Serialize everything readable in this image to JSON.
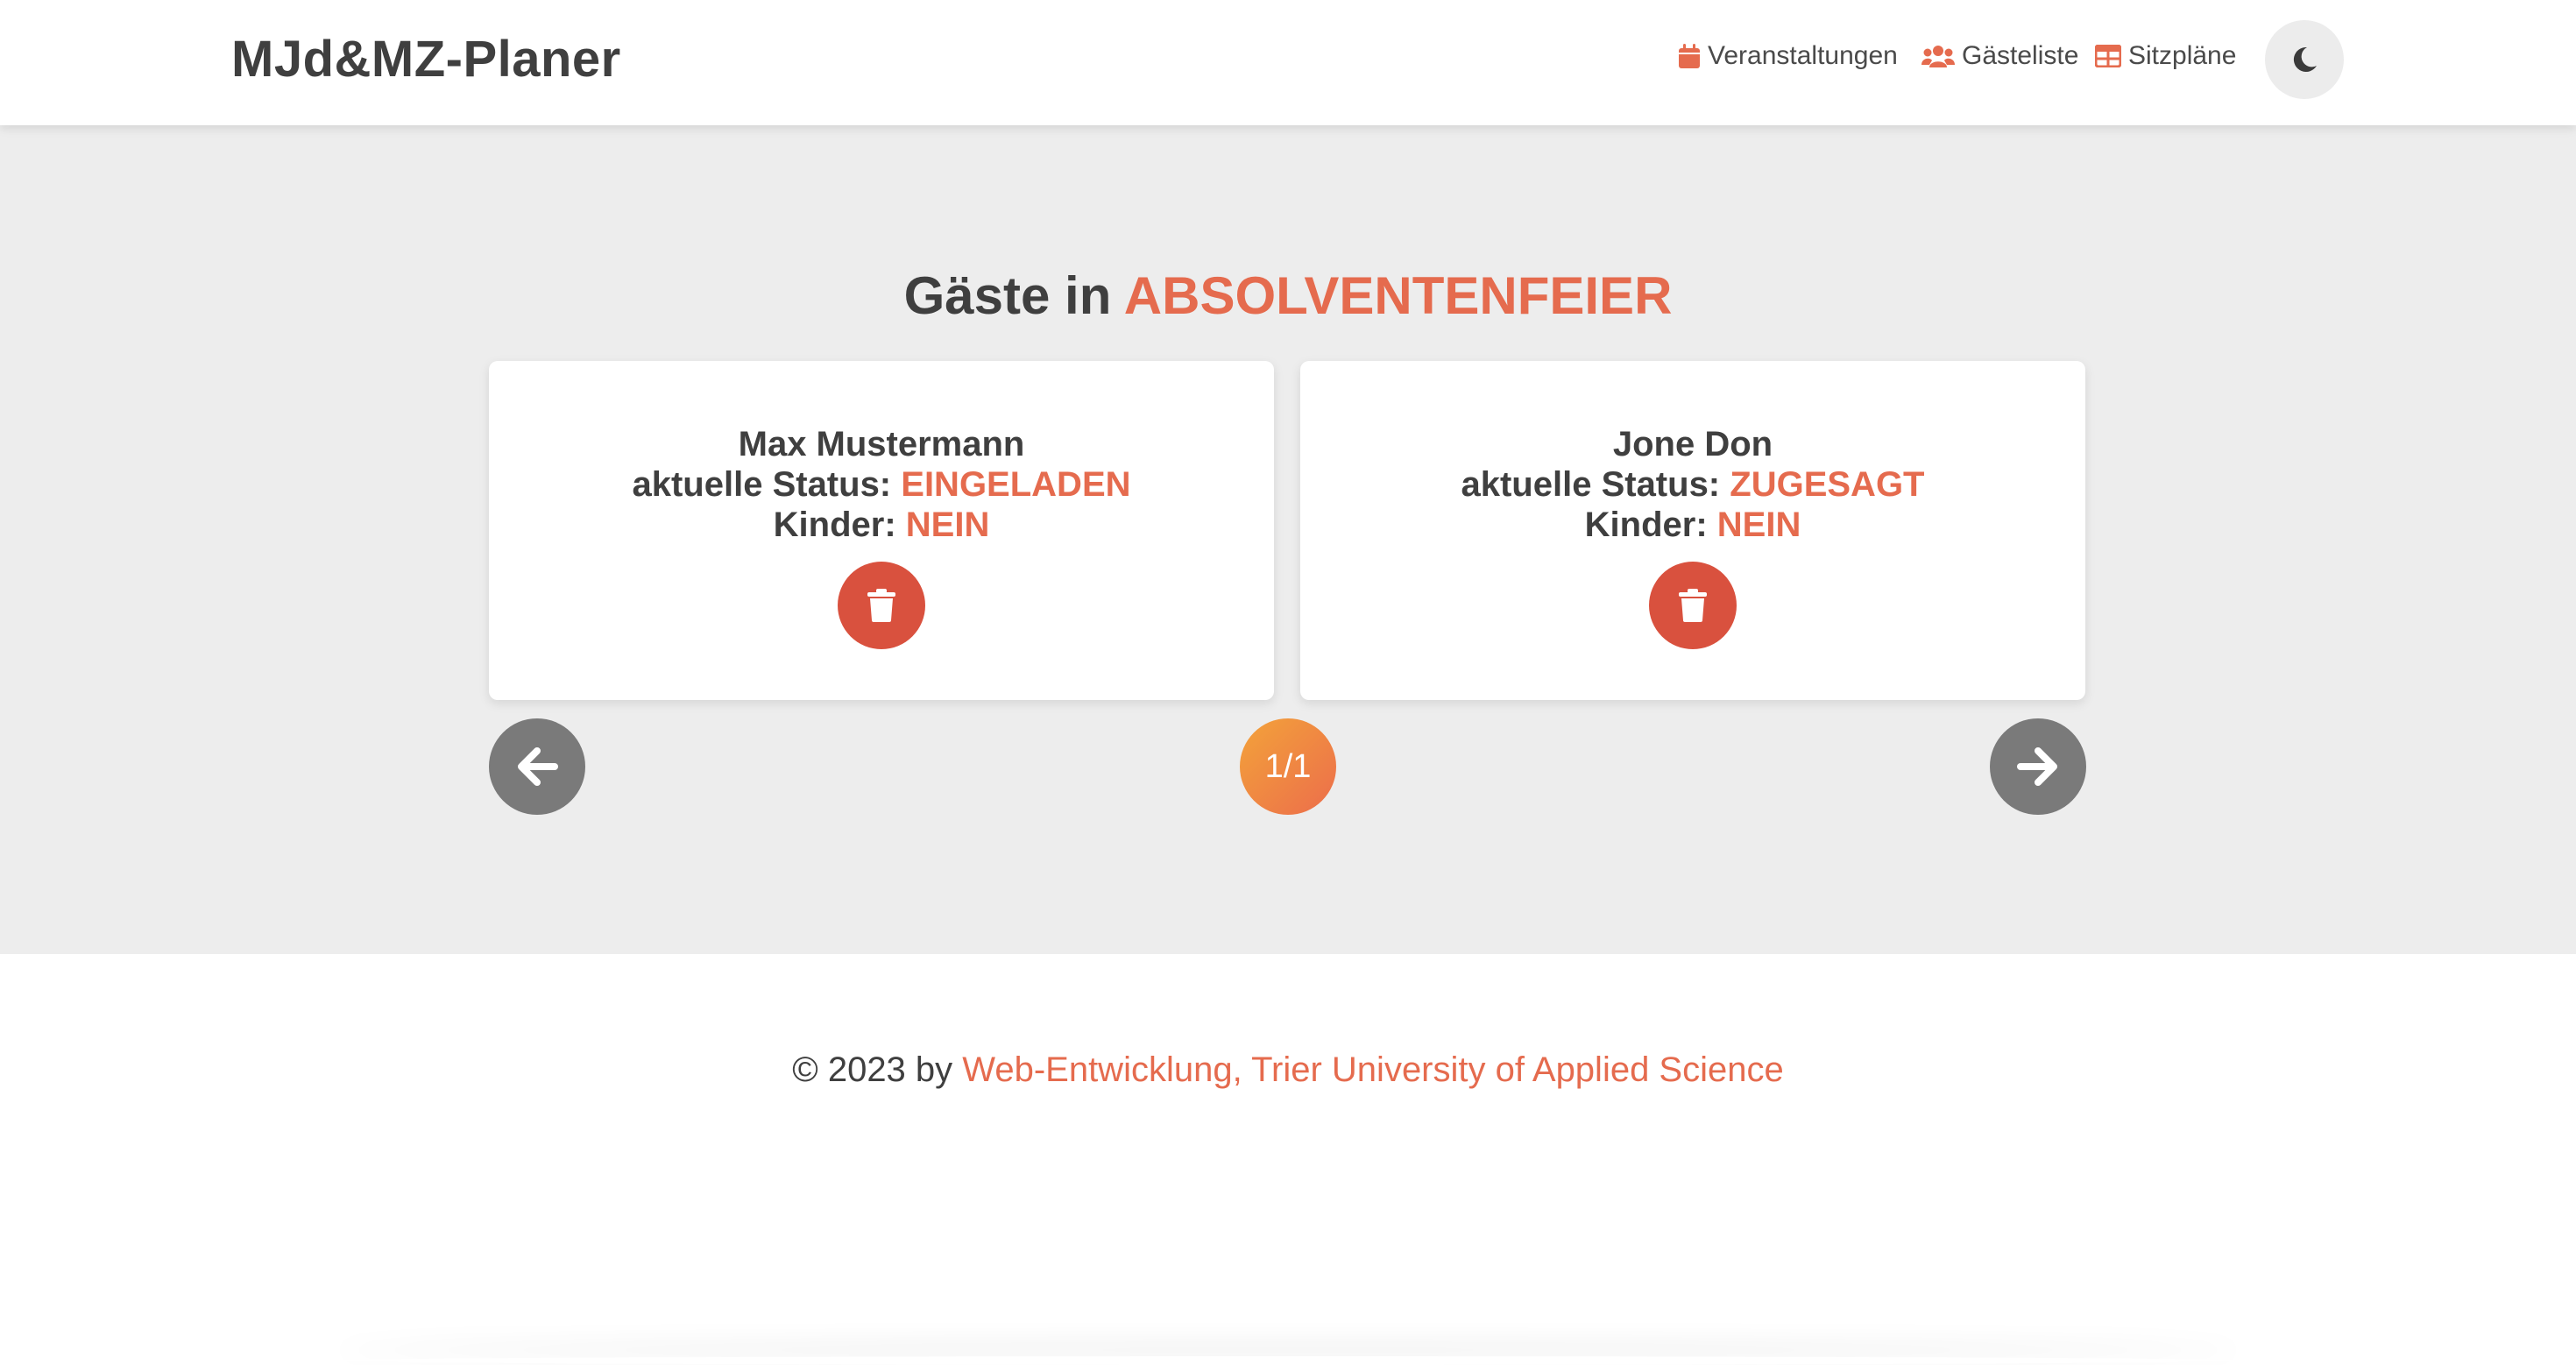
{
  "header": {
    "brand": "MJd&MZ-Planer",
    "nav": [
      {
        "label": "Veranstaltungen",
        "icon": "calendar-icon"
      },
      {
        "label": "Gästeliste",
        "icon": "users-icon"
      },
      {
        "label": "Sitzpläne",
        "icon": "table-icon"
      }
    ],
    "theme_toggle_icon": "moon-icon"
  },
  "main": {
    "title_prefix": "Gäste in",
    "event_name": "ABSOLVENTENFEIER",
    "guests": [
      {
        "name": "Max Mustermann",
        "status_label": "aktuelle Status:",
        "status": "EINGELADEN",
        "kids_label": "Kinder:",
        "kids": "NEIN"
      },
      {
        "name": "Jone Don",
        "status_label": "aktuelle Status:",
        "status": "ZUGESAGT",
        "kids_label": "Kinder:",
        "kids": "NEIN"
      }
    ],
    "pagination": "1/1"
  },
  "footer": {
    "prefix": "© 2023 by",
    "link": "Web-Entwicklung, Trier University of Applied Science"
  },
  "colors": {
    "accent": "#e56b4e",
    "delete": "#d9513e",
    "arrow": "#7a7a7a",
    "badge_from": "#f3a33a",
    "badge_to": "#ec6d4b"
  }
}
